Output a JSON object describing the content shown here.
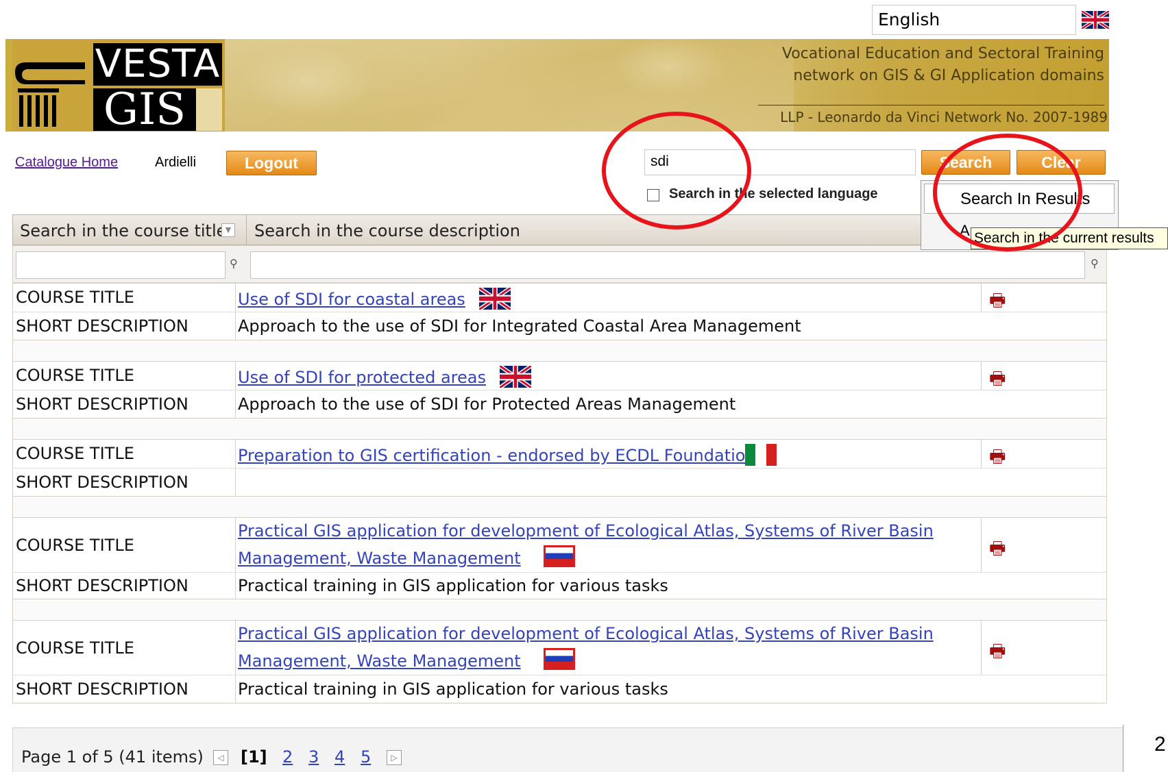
{
  "language": {
    "selected": "English"
  },
  "banner": {
    "logo_top": "VESTA",
    "logo_bottom": "GIS",
    "tagline_line1": "Vocational Education and Sectoral Training",
    "tagline_line2": "network on GIS & GI Application domains",
    "tagline_line3": "LLP - Leonardo da Vinci Network No. 2007-1989"
  },
  "nav": {
    "home_link": "Catalogue Home",
    "user": "Ardielli",
    "logout_label": "Logout"
  },
  "search": {
    "value": "sdi",
    "search_label": "Search",
    "clear_label": "Clear",
    "checkbox_label": "Search in the selected language",
    "checkbox_checked": false
  },
  "menu": {
    "item1": "Search In Results",
    "item2": "A",
    "tooltip": "Search in the current results"
  },
  "grid": {
    "col1_header": "Search in the course title",
    "col2_header": "Search in the course description",
    "label_title": "COURSE TITLE",
    "label_desc": "SHORT DESCRIPTION",
    "records": [
      {
        "title": "Use of SDI for coastal areas",
        "flag": "uk-flag",
        "desc": "Approach to the use of SDI for Integrated Coastal Area Management"
      },
      {
        "title": "Use of SDI for protected areas",
        "flag": "uk-flag",
        "desc": "Approach to the use of SDI for Protected Areas Management"
      },
      {
        "title": "Preparation to GIS certification - endorsed by ECDL Foundation",
        "flag": "italy-flag",
        "desc": ""
      },
      {
        "title_line1": "Practical GIS application for development of Ecological Atlas, Systems of River Basin",
        "title_line2": "Management, Waste Management",
        "flag": "russia-flag",
        "desc": "Practical training in GIS application for various tasks"
      },
      {
        "title_line1": "Practical GIS application for development of Ecological Atlas, Systems of River Basin",
        "title_line2": "Management, Waste Management",
        "flag": "russia-flag",
        "desc": "Practical training in GIS application for various tasks"
      }
    ]
  },
  "pager": {
    "info": "Page 1 of 5 (41 items)",
    "current": "[1]",
    "pages": [
      "2",
      "3",
      "4",
      "5"
    ]
  },
  "slide_number": "2",
  "colors": {
    "button_orange": "#e58a18",
    "link_blue": "#3344bb",
    "annotation_red": "#e8141b"
  }
}
